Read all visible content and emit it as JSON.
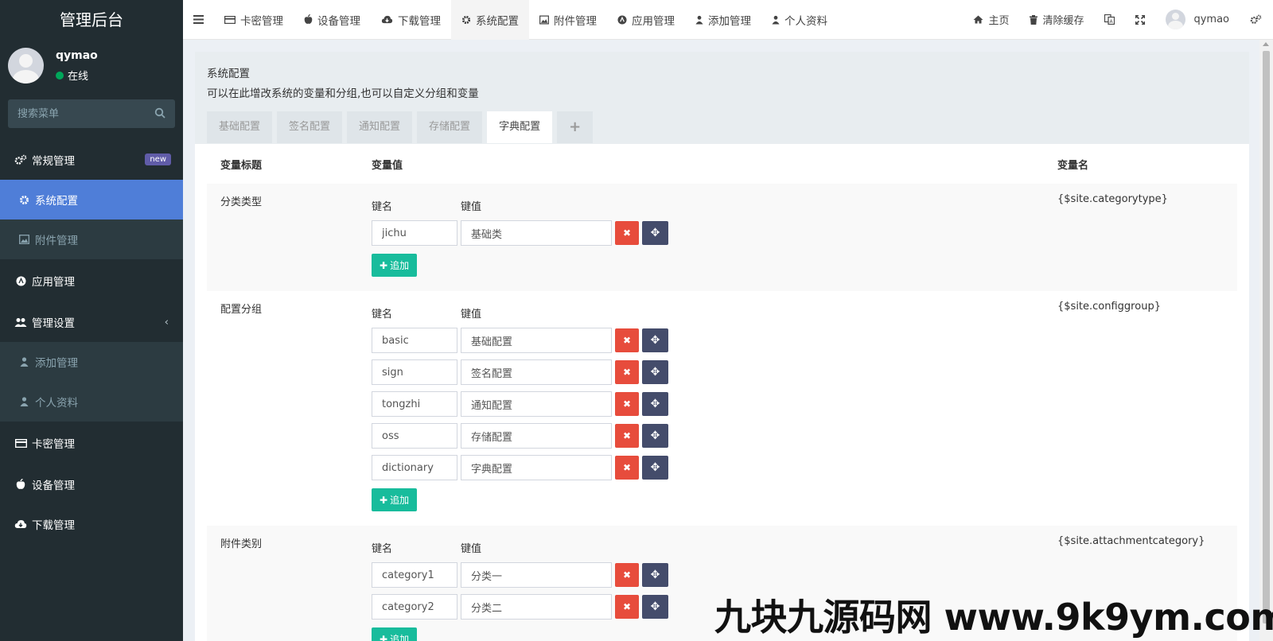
{
  "sidebar": {
    "brand": "管理后台",
    "user": {
      "name": "qymao",
      "status": "在线"
    },
    "search_placeholder": "搜索菜单",
    "items": [
      {
        "label": "常规管理",
        "icon": "cogs-icon",
        "badge": "new"
      },
      {
        "label": "系统配置",
        "icon": "gear-icon",
        "active": true
      },
      {
        "label": "附件管理",
        "icon": "image-icon"
      },
      {
        "label": "应用管理",
        "icon": "app-icon"
      },
      {
        "label": "管理设置",
        "icon": "users-icon"
      },
      {
        "label": "添加管理",
        "icon": "user-icon"
      },
      {
        "label": "个人资料",
        "icon": "user-icon"
      },
      {
        "label": "卡密管理",
        "icon": "card-icon"
      },
      {
        "label": "设备管理",
        "icon": "apple-icon"
      },
      {
        "label": "下载管理",
        "icon": "cloud-download-icon"
      }
    ]
  },
  "topbar": {
    "nav": [
      "卡密管理",
      "设备管理",
      "下载管理",
      "系统配置",
      "附件管理",
      "应用管理",
      "添加管理",
      "个人资料"
    ],
    "home": "主页",
    "clear_cache": "清除缓存",
    "username": "qymao"
  },
  "panel": {
    "title": "系统配置",
    "description": "可以在此增改系统的变量和分组,也可以自定义分组和变量",
    "tabs": [
      "基础配置",
      "签名配置",
      "通知配置",
      "存储配置",
      "字典配置",
      "+"
    ]
  },
  "table": {
    "headers": [
      "变量标题",
      "变量值",
      "变量名"
    ],
    "key_label": "键名",
    "value_label": "键值",
    "add_label": "追加",
    "rows": [
      {
        "title": "分类类型",
        "var_name": "{$site.categorytype}",
        "pairs": [
          {
            "k": "jichu",
            "v": "基础类"
          }
        ]
      },
      {
        "title": "配置分组",
        "var_name": "{$site.configgroup}",
        "pairs": [
          {
            "k": "basic",
            "v": "基础配置"
          },
          {
            "k": "sign",
            "v": "签名配置"
          },
          {
            "k": "tongzhi",
            "v": "通知配置"
          },
          {
            "k": "oss",
            "v": "存储配置"
          },
          {
            "k": "dictionary",
            "v": "字典配置"
          }
        ]
      },
      {
        "title": "附件类别",
        "var_name": "{$site.attachmentcategory}",
        "pairs": [
          {
            "k": "category1",
            "v": "分类一"
          },
          {
            "k": "category2",
            "v": "分类二"
          }
        ]
      }
    ]
  },
  "watermark": "九块九源码网 www.9k9ym.com",
  "colors": {
    "sidebar": "#222d32",
    "active": "#4f7ed8",
    "danger": "#e74c3c",
    "success": "#18bc9c",
    "move": "#444c6b"
  }
}
